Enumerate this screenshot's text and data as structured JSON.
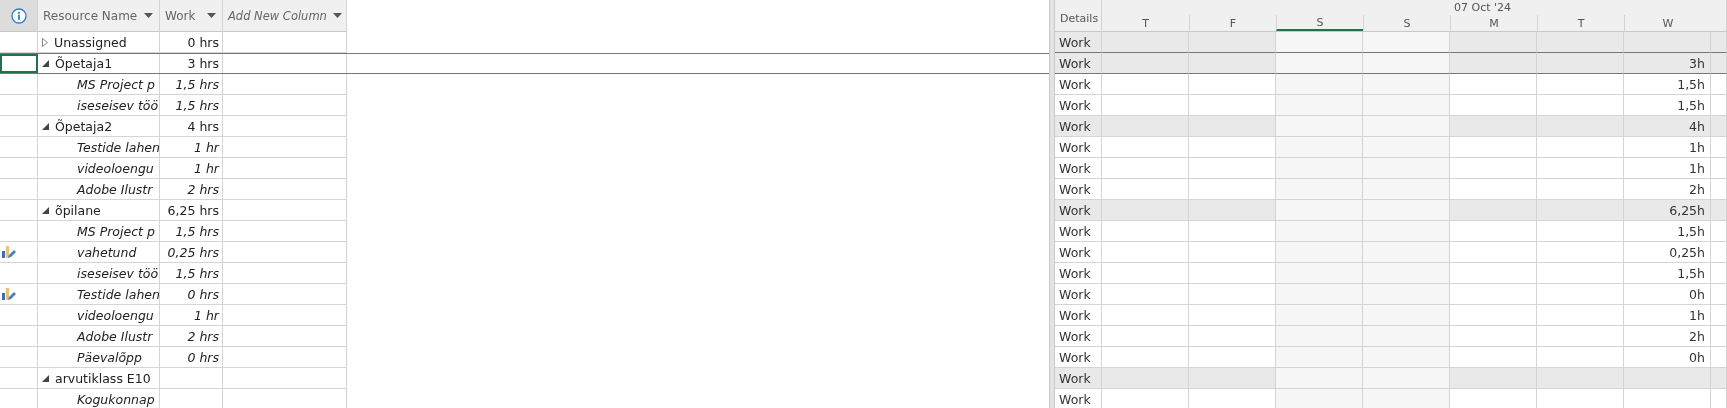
{
  "table": {
    "indicator_header": {
      "kind": "info"
    },
    "columns": [
      {
        "label": "Resource Name",
        "kind": "text"
      },
      {
        "label": "Work",
        "kind": "text"
      },
      {
        "label": "Add New Column",
        "kind": "add"
      }
    ],
    "rows": [
      {
        "kind": "group",
        "name": "Unassigned",
        "work": "0 hrs",
        "expanded": false,
        "selected": false,
        "indicator": false
      },
      {
        "kind": "group",
        "name": "Õpetaja1",
        "work": "3 hrs",
        "expanded": true,
        "selected": true,
        "indicator": false
      },
      {
        "kind": "assignment",
        "name": "MS Project p",
        "work": "1,5 hrs",
        "selected": false,
        "indicator": false
      },
      {
        "kind": "assignment",
        "name": "iseseisev töö",
        "work": "1,5 hrs",
        "selected": false,
        "indicator": false
      },
      {
        "kind": "group",
        "name": "Õpetaja2",
        "work": "4 hrs",
        "expanded": true,
        "selected": false,
        "indicator": false
      },
      {
        "kind": "assignment",
        "name": "Testide lahen",
        "work": "1 hr",
        "selected": false,
        "indicator": false
      },
      {
        "kind": "assignment",
        "name": "videoloengu",
        "work": "1 hr",
        "selected": false,
        "indicator": false
      },
      {
        "kind": "assignment",
        "name": "Adobe Ilustr",
        "work": "2 hrs",
        "selected": false,
        "indicator": false
      },
      {
        "kind": "group",
        "name": "õpilane",
        "work": "6,25 hrs",
        "expanded": true,
        "selected": false,
        "indicator": false
      },
      {
        "kind": "assignment",
        "name": "MS Project p",
        "work": "1,5 hrs",
        "selected": false,
        "indicator": false
      },
      {
        "kind": "assignment",
        "name": "vahetund",
        "work": "0,25 hrs",
        "selected": false,
        "indicator": true
      },
      {
        "kind": "assignment",
        "name": "iseseisev töö",
        "work": "1,5 hrs",
        "selected": false,
        "indicator": false
      },
      {
        "kind": "assignment",
        "name": "Testide lahen",
        "work": "0 hrs",
        "selected": false,
        "indicator": true
      },
      {
        "kind": "assignment",
        "name": "videoloengu",
        "work": "1 hr",
        "selected": false,
        "indicator": false
      },
      {
        "kind": "assignment",
        "name": "Adobe Ilustr",
        "work": "2 hrs",
        "selected": false,
        "indicator": false
      },
      {
        "kind": "assignment",
        "name": "Päevalõpp",
        "work": "0 hrs",
        "selected": false,
        "indicator": false
      },
      {
        "kind": "group",
        "name": "arvutiklass E10",
        "expanded": true,
        "selected": false,
        "indicator": false
      },
      {
        "kind": "assignment",
        "name": "Kogukonnap",
        "selected": false,
        "indicator": false
      }
    ]
  },
  "timescale": {
    "details_label": "Details",
    "date": "07 Oct '24",
    "days": [
      {
        "label": "T",
        "weekend": false,
        "selected": false
      },
      {
        "label": "F",
        "weekend": false,
        "selected": false
      },
      {
        "label": "S",
        "weekend": true,
        "selected": true
      },
      {
        "label": "S",
        "weekend": true,
        "selected": false
      },
      {
        "label": "M",
        "weekend": false,
        "selected": false
      },
      {
        "label": "T",
        "weekend": false,
        "selected": false
      },
      {
        "label": "W",
        "weekend": false,
        "selected": false
      }
    ],
    "rows": [
      {
        "detail": "Work",
        "cells": [
          null,
          null,
          null,
          null,
          null,
          null,
          null
        ]
      },
      {
        "detail": "Work",
        "cells": [
          null,
          null,
          null,
          null,
          null,
          null,
          "3h"
        ]
      },
      {
        "detail": "Work",
        "cells": [
          null,
          null,
          null,
          null,
          null,
          null,
          "1,5h"
        ]
      },
      {
        "detail": "Work",
        "cells": [
          null,
          null,
          null,
          null,
          null,
          null,
          "1,5h"
        ]
      },
      {
        "detail": "Work",
        "cells": [
          null,
          null,
          null,
          null,
          null,
          null,
          "4h"
        ]
      },
      {
        "detail": "Work",
        "cells": [
          null,
          null,
          null,
          null,
          null,
          null,
          "1h"
        ]
      },
      {
        "detail": "Work",
        "cells": [
          null,
          null,
          null,
          null,
          null,
          null,
          "1h"
        ]
      },
      {
        "detail": "Work",
        "cells": [
          null,
          null,
          null,
          null,
          null,
          null,
          "2h"
        ]
      },
      {
        "detail": "Work",
        "cells": [
          null,
          null,
          null,
          null,
          null,
          null,
          "6,25h"
        ]
      },
      {
        "detail": "Work",
        "cells": [
          null,
          null,
          null,
          null,
          null,
          null,
          "1,5h"
        ]
      },
      {
        "detail": "Work",
        "cells": [
          null,
          null,
          null,
          null,
          null,
          null,
          "0,25h"
        ]
      },
      {
        "detail": "Work",
        "cells": [
          null,
          null,
          null,
          null,
          null,
          null,
          "1,5h"
        ]
      },
      {
        "detail": "Work",
        "cells": [
          null,
          null,
          null,
          null,
          null,
          null,
          "0h"
        ]
      },
      {
        "detail": "Work",
        "cells": [
          null,
          null,
          null,
          null,
          null,
          null,
          "1h"
        ]
      },
      {
        "detail": "Work",
        "cells": [
          null,
          null,
          null,
          null,
          null,
          null,
          "2h"
        ]
      },
      {
        "detail": "Work",
        "cells": [
          null,
          null,
          null,
          null,
          null,
          null,
          "0h"
        ]
      },
      {
        "detail": "Work",
        "cells": [
          null,
          null,
          null,
          null,
          null,
          null,
          null
        ]
      },
      {
        "detail": "Work",
        "cells": [
          null,
          null,
          null,
          null,
          null,
          null,
          null
        ]
      }
    ]
  }
}
